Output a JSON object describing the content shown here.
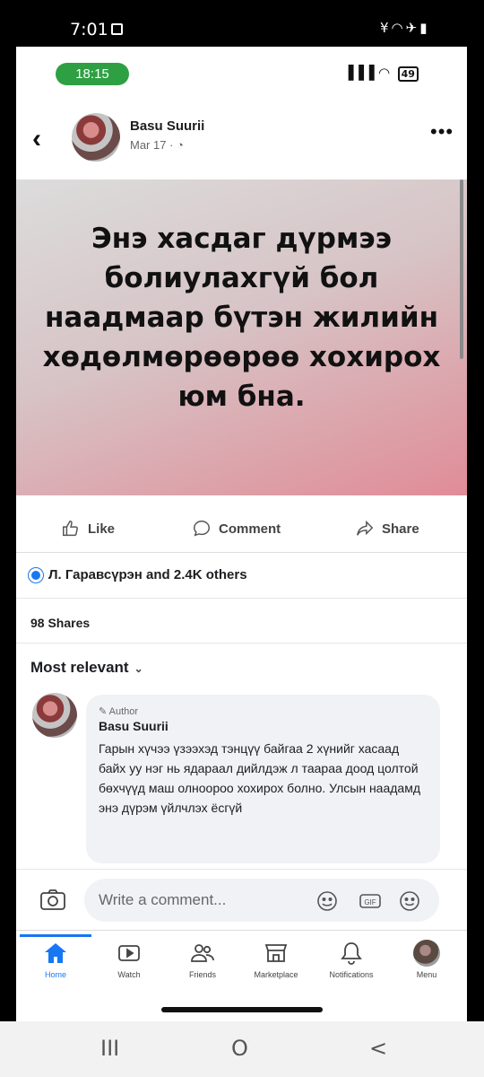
{
  "os_status": {
    "time": "7:01",
    "icons": "¥◠✈▮"
  },
  "inner_status": {
    "time": "18:15",
    "signal": "▐▐▐ ◠",
    "battery": "49"
  },
  "post": {
    "author": "Basu Suurii",
    "date": "Mar 17 · ◔",
    "image_text": "Энэ хасдаг дүрмээ болиулахгүй бол наадмаар бүтэн жилийн хөдөлмөрөөрөө хохирох юм бна.",
    "more": "•••"
  },
  "actions": {
    "like": "Like",
    "comment": "Comment",
    "share": "Share"
  },
  "reactions": "Л. Гаравсүрэн and 2.4K others",
  "shares": "98 Shares",
  "sort": {
    "label": "Most relevant",
    "chevron": "⌄"
  },
  "comment": {
    "tag": "✎ Author",
    "name": "Basu Suurii",
    "text": "Гарын хүчээ үзээхэд тэнцүү байгаа 2 хүнийг хасаад байх уу нэг нь ядараал дийлдэж л таараа доод цолтой бөхчүүд маш олноороо хохирох болно. Улсын наадамд энэ дүрэм үйлчлэх ёсгүй"
  },
  "compose": {
    "placeholder": "Write a comment..."
  },
  "tabs": [
    {
      "label": "Home",
      "icon": "home-icon"
    },
    {
      "label": "Watch",
      "icon": "watch-icon"
    },
    {
      "label": "Friends",
      "icon": "friends-icon"
    },
    {
      "label": "Marketplace",
      "icon": "marketplace-icon"
    },
    {
      "label": "Notifications",
      "icon": "bell-icon"
    },
    {
      "label": "Menu",
      "icon": "menu-avatar"
    }
  ],
  "os_nav": {
    "recents": "III",
    "home": "O",
    "back": "<"
  },
  "colors": {
    "accent": "#1877f2",
    "time_pill": "#2ea043"
  }
}
